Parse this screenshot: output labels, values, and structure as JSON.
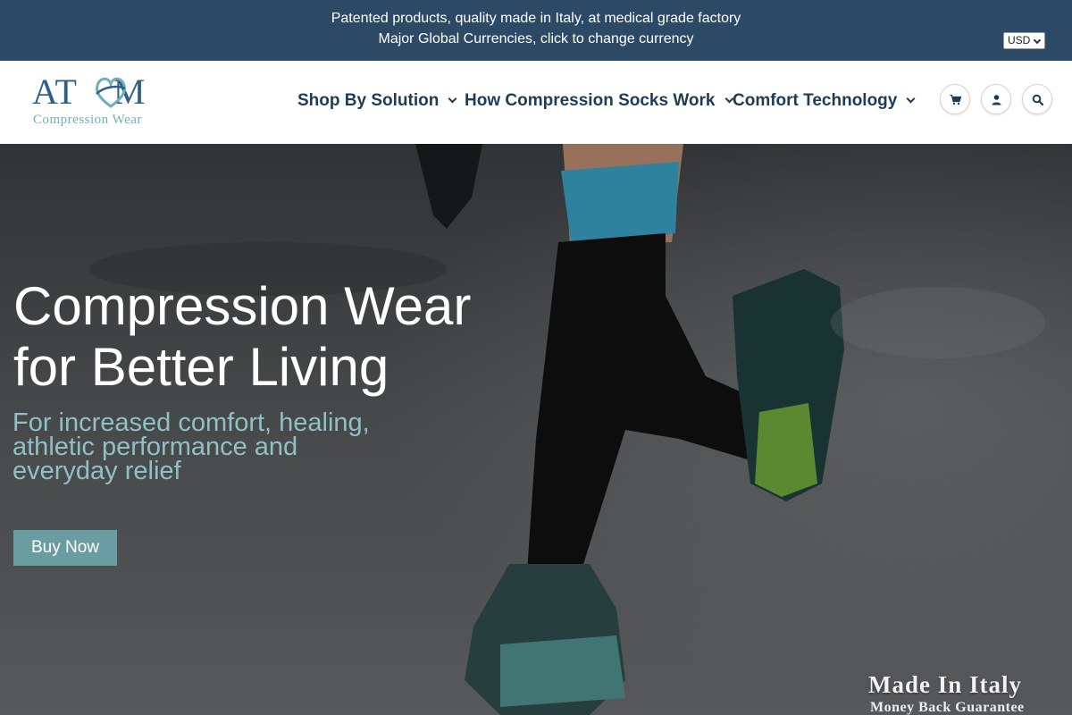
{
  "announcement": {
    "line1": "Patented products, quality made in Italy, at medical grade factory",
    "line2": "Major Global Currencies, click to change currency",
    "currency": "USD"
  },
  "header": {
    "logo": {
      "word": "ATOM",
      "sub": "Compression Wear"
    },
    "nav": [
      {
        "label": "Shop By Solution",
        "icon": "chevron-down-icon"
      },
      {
        "label": "How Compression Socks Work",
        "icon": "chevron-down-icon"
      },
      {
        "label": "Comfort Technology",
        "icon": "chevron-down-icon"
      }
    ],
    "icons": [
      "cart-icon",
      "user-icon",
      "search-icon"
    ]
  },
  "hero": {
    "title_line1": "Compression Wear",
    "title_line2": "for Better Living",
    "subtitle": "For increased comfort, healing, athletic performance and everyday relief",
    "button_label": "Buy Now",
    "badge_line1": "Made In Italy",
    "badge_line2": "Money Back Guarantee"
  },
  "colors": {
    "announcement_bg": "#2c4a66",
    "nav_text": "#1e3c57",
    "logo_blue": "#2f5f86",
    "logo_teal": "#6fb0b8",
    "button_bg": "#6a9da1",
    "subtitle": "#8fc0c6"
  }
}
